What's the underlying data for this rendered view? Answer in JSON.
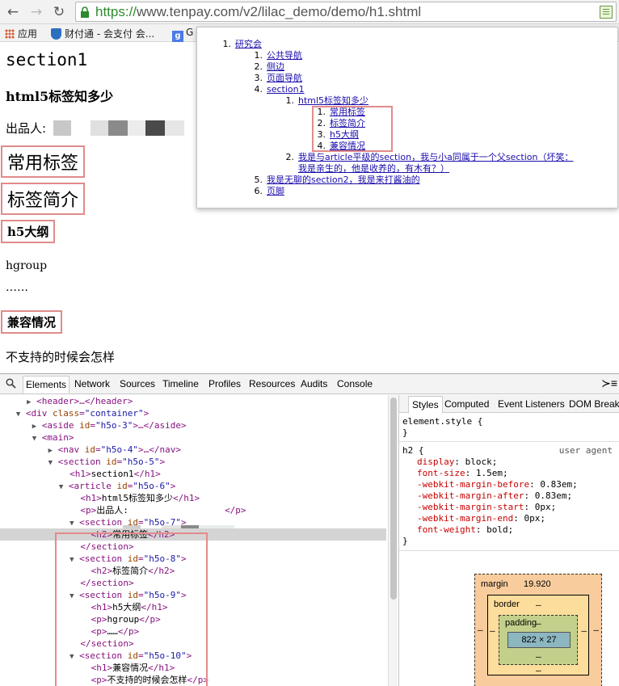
{
  "browser": {
    "url_scheme": "https://",
    "url_rest": "www.tenpay.com/v2/lilac_demo/demo/h1.shtml",
    "bookmarks": [
      "应用",
      "财付通 - 会支付 会...",
      "G"
    ]
  },
  "page": {
    "section_title": "section1",
    "article_title": "html5标签知多少",
    "author_label": "出品人:",
    "h2_common": "常用标签",
    "h2_intro": "标签简介",
    "h1_outline": "h5大纲",
    "p_hgroup": "hgroup",
    "p_ellipsis": "……",
    "h1_compat": "兼容情况",
    "p_unsupported": "不支持的时候会怎样"
  },
  "outline": {
    "n1": "1.",
    "n2": "2.",
    "n3": "3.",
    "n4": "4.",
    "n5": "5.",
    "n6": "6.",
    "root": "研究会",
    "nav": "公共导航",
    "sidebar": "侧边",
    "pagenav": "页面导航",
    "section1": "section1",
    "article": "html5标签知多少",
    "common": "常用标签",
    "intro": "标签简介",
    "h5outline": "h5大纲",
    "compat": "兼容情况",
    "sibling_line1": "我是与article平级的section，我与小a同属于一个父section（坏笑：",
    "sibling_line2": "我是亲生的，他是收养的，有木有？）",
    "section2": "我是无聊的section2，我是来打酱油的",
    "footer": "页脚"
  },
  "devtools": {
    "tabs": [
      "Elements",
      "Network",
      "Sources",
      "Timeline",
      "Profiles",
      "Resources",
      "Audits",
      "Console"
    ],
    "elements": {
      "l1": "<header>…</header>",
      "l2_open": "<div ",
      "l2_attr": "class",
      "l2_val": "\"container\"",
      "l3_attr": "id",
      "l3_val": "\"h5o-3\"",
      "l3_tag": "aside",
      "l4": "<main>",
      "l5_tag": "nav",
      "l5_val": "\"h5o-4\"",
      "l6_val": "\"h5o-5\"",
      "l7": "section1",
      "l8_val": "\"h5o-6\"",
      "l9": "html5标签知多少",
      "l10": "出品人:",
      "l11_val": "\"h5o-7\"",
      "l12": "常用标签",
      "l14_val": "\"h5o-8\"",
      "l15": "标签简介",
      "l17_val": "\"h5o-9\"",
      "l18": "h5大纲",
      "l19": "hgroup",
      "l20": "……",
      "l22_val": "\"h5o-10\"",
      "l23": "兼容情况",
      "l24": "不支持的时候会怎样"
    },
    "styles": {
      "tabs": [
        "Styles",
        "Computed",
        "Event Listeners",
        "DOM Breakpoi"
      ],
      "element_style": "element.style {",
      "close": "}",
      "rule_selector": "h2 {",
      "rule_source": "user agent",
      "props": [
        [
          "display",
          "block;"
        ],
        [
          "font-size",
          "1.5em;"
        ],
        [
          "-webkit-margin-before",
          "0.83em;"
        ],
        [
          "-webkit-margin-after",
          "0.83em;"
        ],
        [
          "-webkit-margin-start",
          "0px;"
        ],
        [
          "-webkit-margin-end",
          "0px;"
        ],
        [
          "font-weight",
          "bold;"
        ]
      ],
      "box_model": {
        "margin_label": "margin",
        "margin_value": "19.920",
        "border_label": "border",
        "padding_label": "padding",
        "content_size": "822 × 27",
        "dash": "–"
      }
    }
  },
  "colors": {
    "highlight_box": "#e28b8b",
    "link": "#1a0dab",
    "url_green": "#2d8a2d"
  }
}
